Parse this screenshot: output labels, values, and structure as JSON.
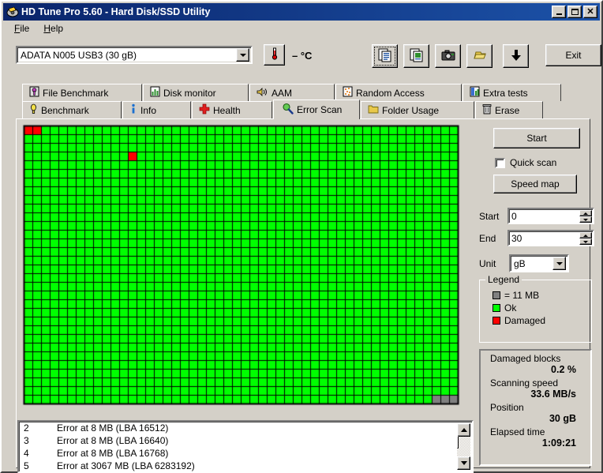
{
  "window": {
    "title": "HD Tune Pro 5.60 - Hard Disk/SSD Utility",
    "icon": "hdtune-app-icon",
    "minimize": "_",
    "maximize": "□",
    "close": "✕"
  },
  "menu": {
    "items": [
      {
        "label": "File",
        "accel": "F"
      },
      {
        "label": "Help",
        "accel": "H"
      }
    ]
  },
  "toolbar": {
    "drive_selected": "ADATA N005 USB3 (30 gB)",
    "temperature": "– °C",
    "temp_icon": "thermometer-icon",
    "buttons": [
      {
        "name": "copy-icon",
        "label": ""
      },
      {
        "name": "copy-image-icon",
        "label": ""
      },
      {
        "name": "camera-icon",
        "label": ""
      },
      {
        "name": "folder-icon",
        "label": ""
      },
      {
        "name": "download-arrow-icon",
        "label": ""
      }
    ],
    "exit_label": "Exit"
  },
  "tabs_row1": [
    {
      "label": "File Benchmark",
      "icon": "file-benchmark-icon"
    },
    {
      "label": "Disk monitor",
      "icon": "disk-monitor-icon"
    },
    {
      "label": "AAM",
      "icon": "speaker-icon"
    },
    {
      "label": "Random Access",
      "icon": "random-access-icon"
    },
    {
      "label": "Extra tests",
      "icon": "extra-tests-icon"
    }
  ],
  "tabs_row2": [
    {
      "label": "Benchmark",
      "icon": "benchmark-icon",
      "active": false
    },
    {
      "label": "Info",
      "icon": "info-icon",
      "active": false
    },
    {
      "label": "Health",
      "icon": "health-icon",
      "active": false
    },
    {
      "label": "Error Scan",
      "icon": "magnifier-icon",
      "active": true
    },
    {
      "label": "Folder Usage",
      "icon": "folder-usage-icon",
      "active": false
    },
    {
      "label": "Erase",
      "icon": "trash-icon",
      "active": false
    }
  ],
  "controls": {
    "start_label": "Start",
    "quick_scan_label": "Quick scan",
    "quick_scan_checked": false,
    "speed_map_label": "Speed map",
    "start_field_label": "Start",
    "start_field_value": "0",
    "end_field_label": "End",
    "end_field_value": "30",
    "unit_label": "Unit",
    "unit_value": "gB"
  },
  "legend": {
    "title": "Legend",
    "items": [
      {
        "label": "= 11 MB",
        "color": "#808080"
      },
      {
        "label": "Ok",
        "color": "#00ff00"
      },
      {
        "label": "Damaged",
        "color": "#ff0000"
      }
    ]
  },
  "stats": [
    {
      "label": "Damaged blocks",
      "value": "0.2 %"
    },
    {
      "label": "Scanning speed",
      "value": "33.6 MB/s"
    },
    {
      "label": "Position",
      "value": "30 gB"
    },
    {
      "label": "Elapsed time",
      "value": "1:09:21"
    }
  ],
  "error_list": [
    {
      "num": "2",
      "text": "Error at 8 MB (LBA 16512)"
    },
    {
      "num": "3",
      "text": "Error at 8 MB (LBA 16640)"
    },
    {
      "num": "4",
      "text": "Error at 8 MB (LBA 16768)"
    },
    {
      "num": "5",
      "text": "Error at 3067 MB (LBA 6283192)"
    }
  ],
  "error_map": {
    "columns": 50,
    "rows": 32,
    "cell": 11,
    "ok_color": "#00ff00",
    "damaged_color": "#ff0000",
    "unscanned_color": "#808080",
    "grid_color": "#000000",
    "damaged_cells": [
      [
        0,
        0
      ],
      [
        1,
        0
      ],
      [
        12,
        3
      ]
    ],
    "unscanned_cells": [
      [
        47,
        31
      ],
      [
        48,
        31
      ],
      [
        49,
        31
      ]
    ]
  }
}
